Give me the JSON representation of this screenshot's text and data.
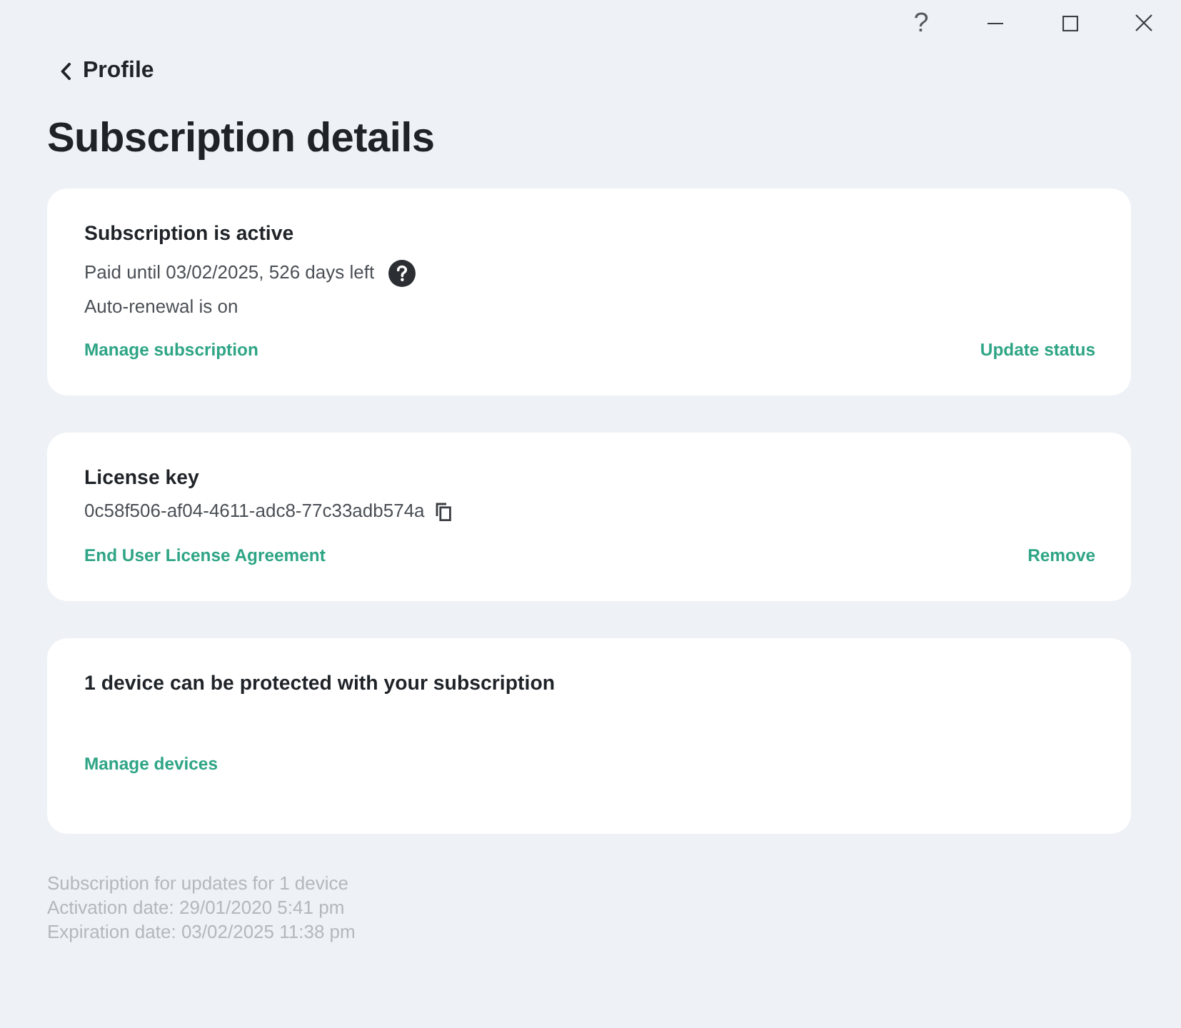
{
  "window": {
    "help": "?"
  },
  "back": {
    "label": "Profile"
  },
  "title": "Subscription details",
  "cards": [
    {
      "kind": "status",
      "title": "Subscription is active",
      "lines": [
        {
          "kind": "expiry",
          "text": "Paid until 03/02/2025, 526 days left"
        },
        {
          "kind": "plain",
          "text": "Auto-renewal is on"
        }
      ],
      "links": [
        "Manage subscription",
        "Update status"
      ]
    },
    {
      "kind": "license",
      "title": "License key",
      "lines": [
        {
          "kind": "key",
          "text": "0c58f506-af04-4611-adc8-77c33adb574a"
        }
      ],
      "links": [
        "End User License Agreement",
        "Remove"
      ]
    },
    {
      "kind": "devices",
      "title": "1 device can be protected with your subscription",
      "links": [
        "Manage devices"
      ]
    }
  ],
  "footer": [
    "Subscription for updates for 1 device",
    "Activation date: 29/01/2020 5:41 pm",
    "Expiration date: 03/02/2025 11:38 pm"
  ]
}
